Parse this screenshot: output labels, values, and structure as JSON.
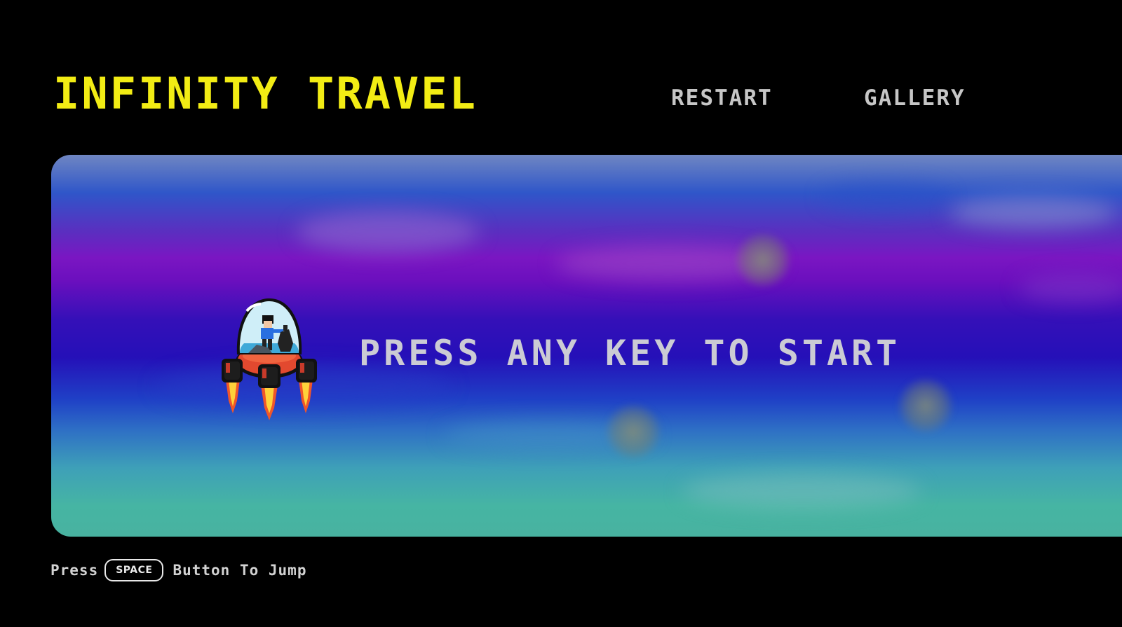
{
  "header": {
    "title": "INFINITY TRAVEL",
    "nav": {
      "restart_label": "RESTART",
      "gallery_label": "GALLERY"
    }
  },
  "game": {
    "prompt": "PRESS ANY KEY TO START",
    "player_sprite": "rocket-pod-icon"
  },
  "footer": {
    "hint_prefix": "Press",
    "key_label": "SPACE",
    "hint_suffix": "Button To Jump"
  },
  "colors": {
    "background": "#000000",
    "title": "#f2ec14",
    "nav_text": "#c6c6c6",
    "prompt_text": "#cbcbd4"
  }
}
